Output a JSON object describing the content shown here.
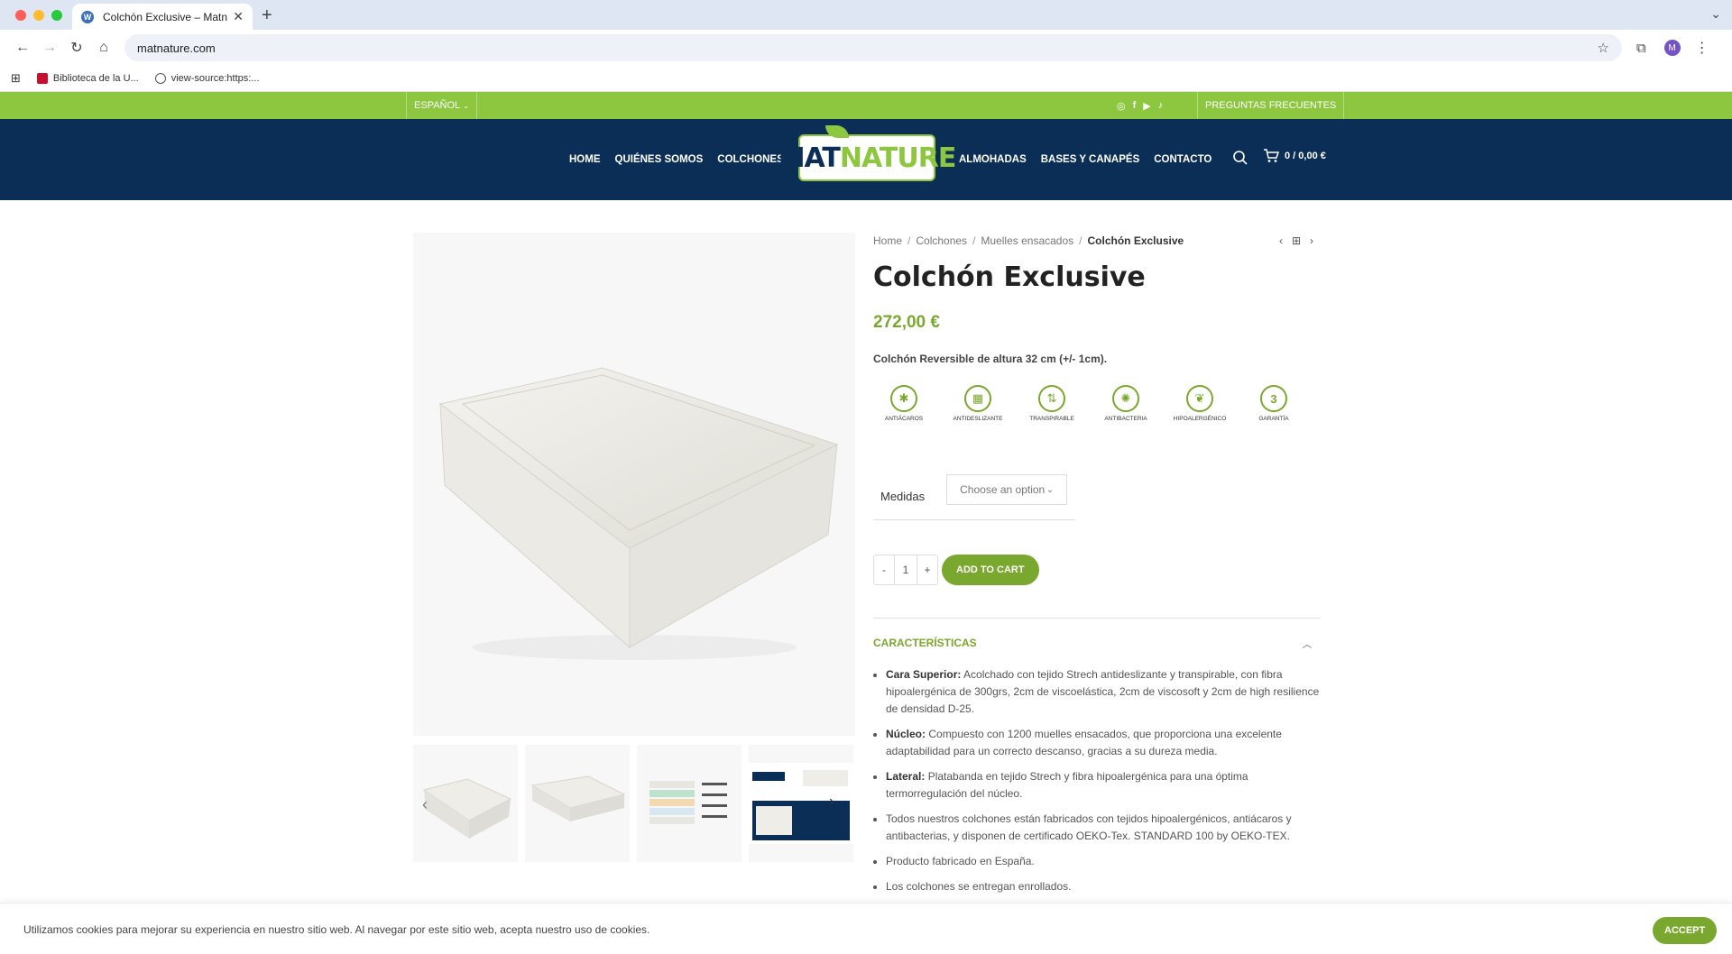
{
  "browser": {
    "tab_title": "Colchón Exclusive – Matnature",
    "url": "matnature.com",
    "bookmarks": [
      {
        "label": "Biblioteca de la U..."
      },
      {
        "label": "view-source:https:..."
      }
    ],
    "profile_initial": "M"
  },
  "topbar": {
    "language": "ESPAÑOL",
    "faq": "PREGUNTAS FRECUENTES"
  },
  "header": {
    "menu_left": [
      "HOME",
      "QUIÉNES SOMOS",
      "COLCHONES"
    ],
    "menu_right": [
      "ALMOHADAS",
      "BASES Y CANAPÉS",
      "CONTACTO"
    ],
    "logo": {
      "mat": "MAT",
      "nature": "NATURE"
    },
    "cart": "0 / 0,00 €"
  },
  "product": {
    "breadcrumbs": [
      "Home",
      "Colchones",
      "Muelles ensacados",
      "Colchón Exclusive"
    ],
    "title": "Colchón Exclusive",
    "price": "272,00 €",
    "short_description": "Colchón Reversible de altura 32 cm (+/- 1cm).",
    "features": [
      {
        "label": "ANTIÁCAROS",
        "icon": "mite-icon"
      },
      {
        "label": "ANTIDESLIZANTE",
        "icon": "grid-icon"
      },
      {
        "label": "TRANSPIRABLE",
        "icon": "air-icon"
      },
      {
        "label": "ANTIBACTERIA",
        "icon": "bacteria-icon"
      },
      {
        "label": "HIPOALERGÉNICO",
        "icon": "leaf-drop-icon"
      },
      {
        "label": "GARANTÍA",
        "icon": "warranty-icon",
        "badge": "3"
      }
    ],
    "variation_label": "Medidas",
    "variation_placeholder": "Choose an option",
    "quantity": "1",
    "qty_minus": "-",
    "qty_plus": "+",
    "add_to_cart": "ADD TO CART",
    "accordion_title": "CARACTERÍSTICAS",
    "characteristics": [
      {
        "bold": "Cara Superior:",
        "text": " Acolchado con tejido Strech antideslizante y transpirable, con fibra hipoalergénica de 300grs, 2cm de viscoelástica, 2cm de viscosoft y 2cm de high resilience de densidad D-25."
      },
      {
        "bold": "Núcleo:",
        "text": " Compuesto con 1200 muelles ensacados, que proporciona una excelente adaptabilidad para un correcto descanso, gracias a su dureza media."
      },
      {
        "bold": "Lateral:",
        "text": " Platabanda en tejido Strech y fibra hipoalergénica para una óptima termorregulación del núcleo."
      },
      {
        "bold": "",
        "text": "Todos nuestros colchones están fabricados con tejidos hipoalergénicos, antiácaros y antibacterias, y disponen de certificado OEKO-Tex. STANDARD 100 by OEKO-TEX."
      },
      {
        "bold": "",
        "text": "Producto fabricado en España."
      },
      {
        "bold": "",
        "text": "Los colchones se entregan enrollados."
      }
    ]
  },
  "cookie": {
    "text": "Utilizamos cookies para mejorar su experiencia en nuestro sitio web. Al navegar por este sitio web, acepta nuestro uso de cookies.",
    "accept": "ACCEPT"
  },
  "colors": {
    "brand_green": "#8dc63f",
    "accent_green": "#7aa82e",
    "navy": "#0b2e57"
  }
}
